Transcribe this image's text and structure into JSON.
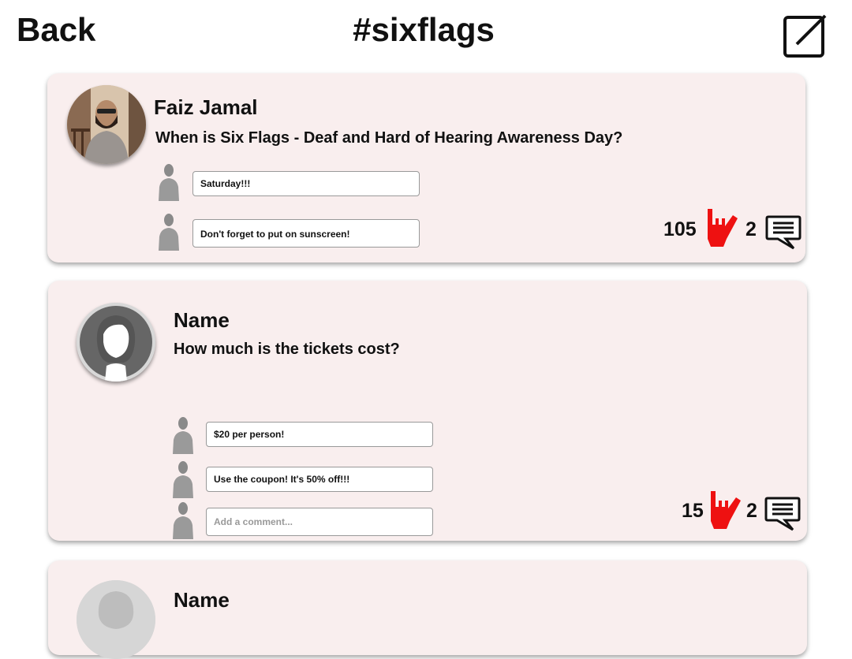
{
  "header": {
    "back_label": "Back",
    "title": "#sixflags"
  },
  "posts": [
    {
      "author": "Faiz Jamal",
      "question": "When is Six Flags - Deaf and Hard of Hearing Awareness Day?",
      "comments": [
        "Saturday!!!",
        "Don't forget to put on sunscreen!"
      ],
      "likes": "105",
      "comment_count": "2"
    },
    {
      "author": "Name",
      "question": "How much is the tickets cost?",
      "comments": [
        "$20 per person!",
        "Use the coupon! It's 50% off!!!"
      ],
      "comment_placeholder": "Add a comment...",
      "likes": "15",
      "comment_count": "2"
    },
    {
      "author": "Name"
    }
  ],
  "colors": {
    "card_bg": "#f9eeee",
    "like_hand": "#ee1111",
    "placeholder_avatar": "#666666"
  },
  "icons": {
    "compose": "compose-icon",
    "like": "ily-hand-icon",
    "comments": "speech-bubble-icon",
    "user": "user-silhouette-icon"
  }
}
